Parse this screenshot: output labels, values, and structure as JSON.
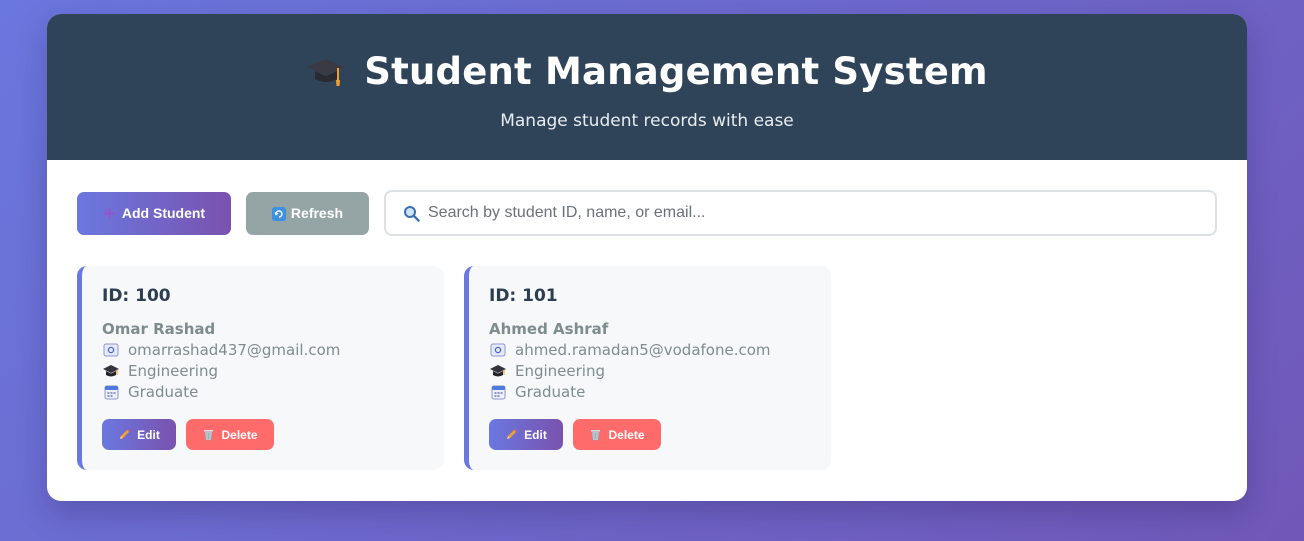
{
  "header": {
    "title": "Student Management System",
    "subtitle": "Manage student records with ease",
    "icon": "graduation-cap-icon"
  },
  "toolbar": {
    "add_label": "Add Student",
    "add_icon": "plus-icon",
    "refresh_label": "Refresh",
    "refresh_icon": "refresh-icon",
    "search_placeholder": "Search by student ID, name, or email...",
    "search_value": ""
  },
  "students": [
    {
      "id_label": "ID: 100",
      "name": "Omar Rashad",
      "email": "omarrashad437@gmail.com",
      "department": "Engineering",
      "status": "Graduate"
    },
    {
      "id_label": "ID: 101",
      "name": "Ahmed Ashraf",
      "email": "ahmed.ramadan5@vodafone.com",
      "department": "Engineering",
      "status": "Graduate"
    }
  ],
  "card_actions": {
    "edit_label": "Edit",
    "delete_label": "Delete"
  },
  "colors": {
    "accent_start": "#6a78e0",
    "accent_end": "#7a52ae",
    "header_bg": "#2f4459",
    "delete": "#ff6b6b",
    "refresh": "#95a5a6"
  }
}
